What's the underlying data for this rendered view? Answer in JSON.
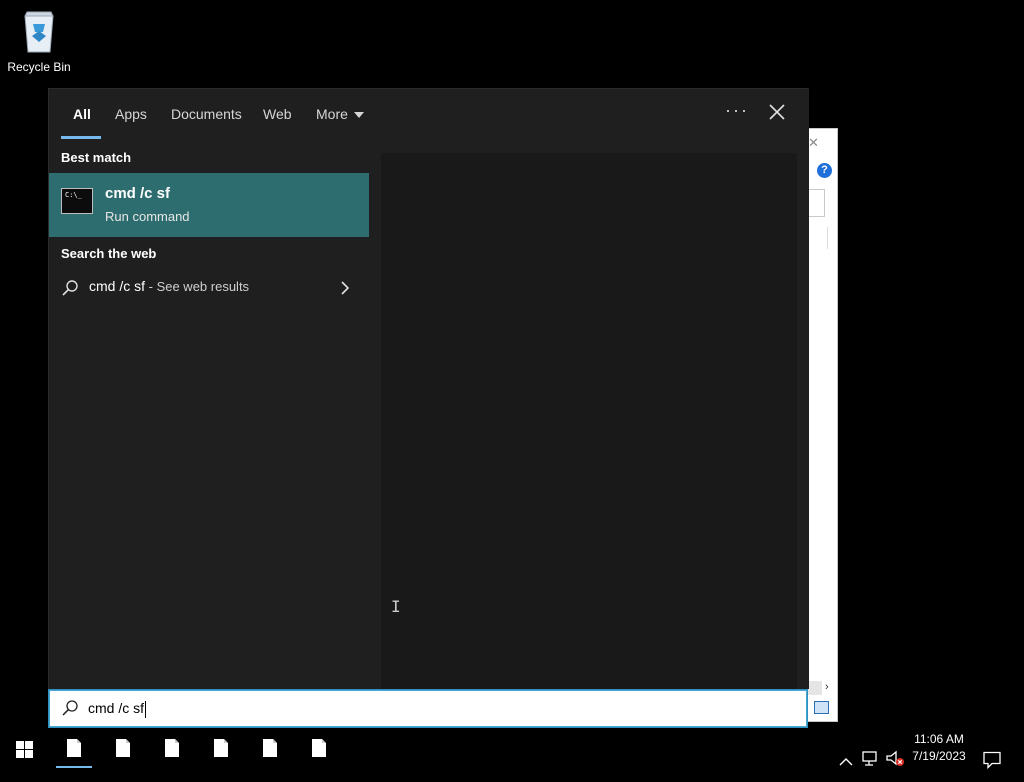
{
  "desktop": {
    "recycle_bin_label": "Recycle Bin"
  },
  "search_panel": {
    "tabs": [
      {
        "label": "All",
        "active": true
      },
      {
        "label": "Apps"
      },
      {
        "label": "Documents"
      },
      {
        "label": "Web"
      },
      {
        "label": "More"
      }
    ],
    "best_match_header": "Best match",
    "best_match": {
      "title": "cmd /c sf",
      "subtitle": "Run command",
      "icon_text": "C:\\_"
    },
    "web_header": "Search the web",
    "web_result": {
      "query": "cmd /c sf",
      "suffix": " - See web results"
    }
  },
  "searchbox": {
    "value": "cmd /c sf"
  },
  "taskbar": {
    "pinned_apps": [
      "file-icon",
      "file-icon",
      "file-icon",
      "file-icon",
      "file-icon",
      "file-icon"
    ],
    "clock_time": "11:06 AM",
    "clock_date": "7/19/2023"
  },
  "background_window": {
    "help_glyph": "?"
  },
  "colors": {
    "accent": "#76b9ed",
    "best_match_bg": "#2d6d6f",
    "panel_bg": "#1f1f1f"
  }
}
